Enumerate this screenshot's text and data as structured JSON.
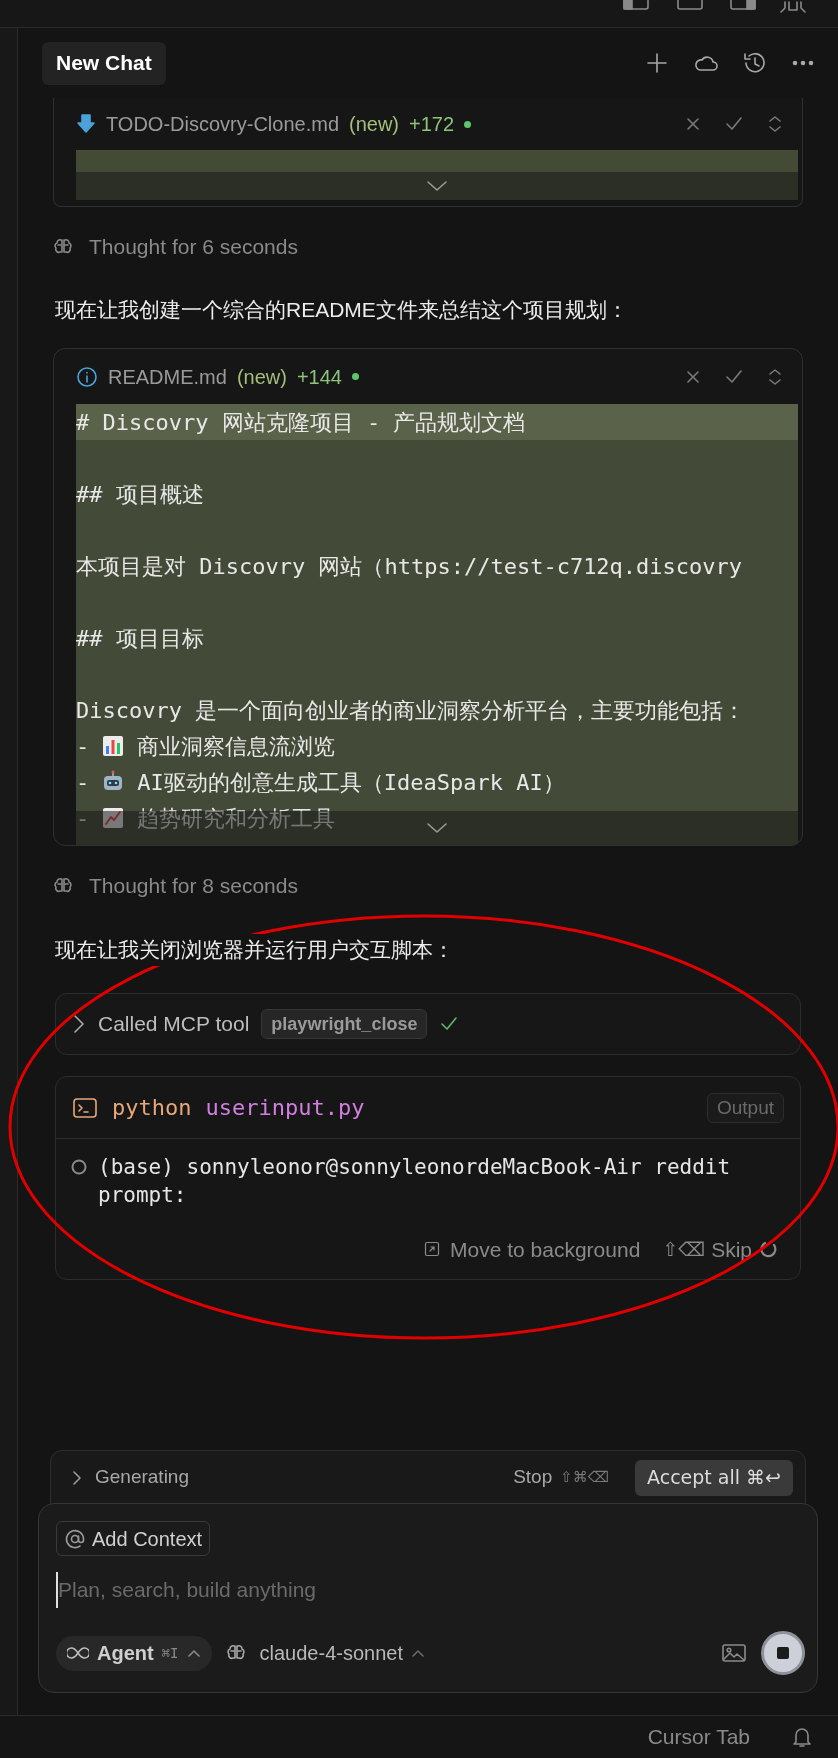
{
  "header": {
    "title": "New Chat"
  },
  "messages": [
    {
      "kind": "file_edit",
      "filename": "TODO-Discovry-Clone.md",
      "status": "(new)",
      "additions": "+172"
    },
    {
      "kind": "thought",
      "text": "Thought for 6 seconds"
    },
    {
      "kind": "text",
      "text": "现在让我创建一个综合的README文件来总结这个项目规划："
    },
    {
      "kind": "file_edit",
      "filename": "README.md",
      "status": "(new)",
      "additions": "+144",
      "lines": [
        {
          "kind": "text",
          "text": "# Discovry 网站克隆项目 - 产品规划文档",
          "highlighted": true
        },
        {
          "kind": "blank",
          "highlighted": false
        },
        {
          "kind": "text",
          "text": "## 项目概述",
          "highlighted": false
        },
        {
          "kind": "blank",
          "highlighted": false
        },
        {
          "kind": "text",
          "text": "本项目是对 Discovry 网站（https://test-c712q.discovry",
          "highlighted": false
        },
        {
          "kind": "blank",
          "highlighted": false
        },
        {
          "kind": "text",
          "text": "## 项目目标",
          "highlighted": false
        },
        {
          "kind": "blank",
          "highlighted": false
        },
        {
          "kind": "text",
          "text": "Discovry 是一个面向创业者的商业洞察分析平台，主要功能包括：",
          "highlighted": false
        },
        {
          "kind": "bullet",
          "marker": "-",
          "text": "商业洞察信息流浏览",
          "highlighted": false
        },
        {
          "kind": "bullet",
          "marker": "-",
          "text": "AI驱动的创意生成工具（IdeaSpark AI）",
          "highlighted": false
        },
        {
          "kind": "bullet",
          "marker": "-",
          "text": "趋势研究和分析工具",
          "highlighted": false
        }
      ]
    },
    {
      "kind": "thought",
      "text": "Thought for 8 seconds"
    },
    {
      "kind": "text",
      "text": "现在让我关闭浏览器并运行用户交互脚本："
    },
    {
      "kind": "tool_call",
      "label": "Called MCP tool",
      "tool": "playwright_close",
      "done": true
    },
    {
      "kind": "terminal",
      "command": "python",
      "argument": "userinput.py",
      "output_button": "Output",
      "lines": [
        "(base) sonnyleonor@sonnyleonordeMacBook-Air reddit",
        "prompt:"
      ],
      "move_action": "Move to background",
      "skip_keys": "⇧⌫",
      "skip_action": "Skip"
    }
  ],
  "generating_bar": {
    "label": "Generating",
    "stop": "Stop",
    "stop_keys": "⇧⌘⌫",
    "accept": "Accept all ⌘↩"
  },
  "composer": {
    "context_button": "Add Context",
    "placeholder": "Plan, search, build anything",
    "mode": "Agent",
    "mode_keys": "⌘I",
    "model": "claude-4-sonnet"
  },
  "status_bar": {
    "text": "Cursor Tab"
  },
  "annotations": [
    {
      "kind": "ellipse"
    }
  ]
}
